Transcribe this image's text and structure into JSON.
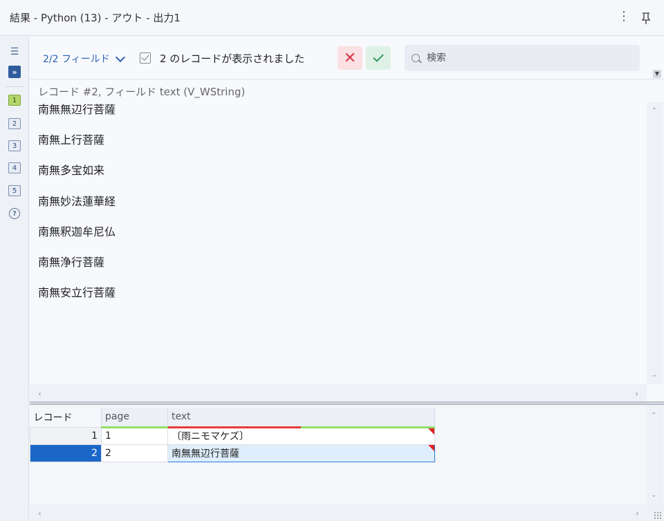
{
  "window": {
    "title": "結果 - Python (13) - アウト - 出力1"
  },
  "leftbar": {
    "badges": [
      "1",
      "2",
      "3",
      "4",
      "5"
    ],
    "help": "?"
  },
  "toolbar": {
    "fields_dropdown": "2/2 フィールド",
    "record_status": "2 のレコードが表示されました",
    "search_placeholder": "検索"
  },
  "detail": {
    "header": "レコード #2, フィールド text (V_WString)",
    "lines": [
      "南無無辺行菩薩",
      "南無上行菩薩",
      "南無多宝如来",
      "南無妙法蓮華経",
      "南無釈迦牟尼仏",
      "南無浄行菩薩",
      "南無安立行菩薩"
    ]
  },
  "grid": {
    "columns": [
      "レコード",
      "page",
      "text"
    ],
    "rows": [
      {
        "record": "1",
        "page": "1",
        "text": "〔雨ニモマケズ〕"
      },
      {
        "record": "2",
        "page": "2",
        "text": "南無無辺行菩薩"
      }
    ],
    "selected_row": 2
  },
  "colors": {
    "accent": "#1b66c9",
    "reject": "#d6394a",
    "accept": "#2f9a5f",
    "active_badge": "#b4d66b"
  }
}
